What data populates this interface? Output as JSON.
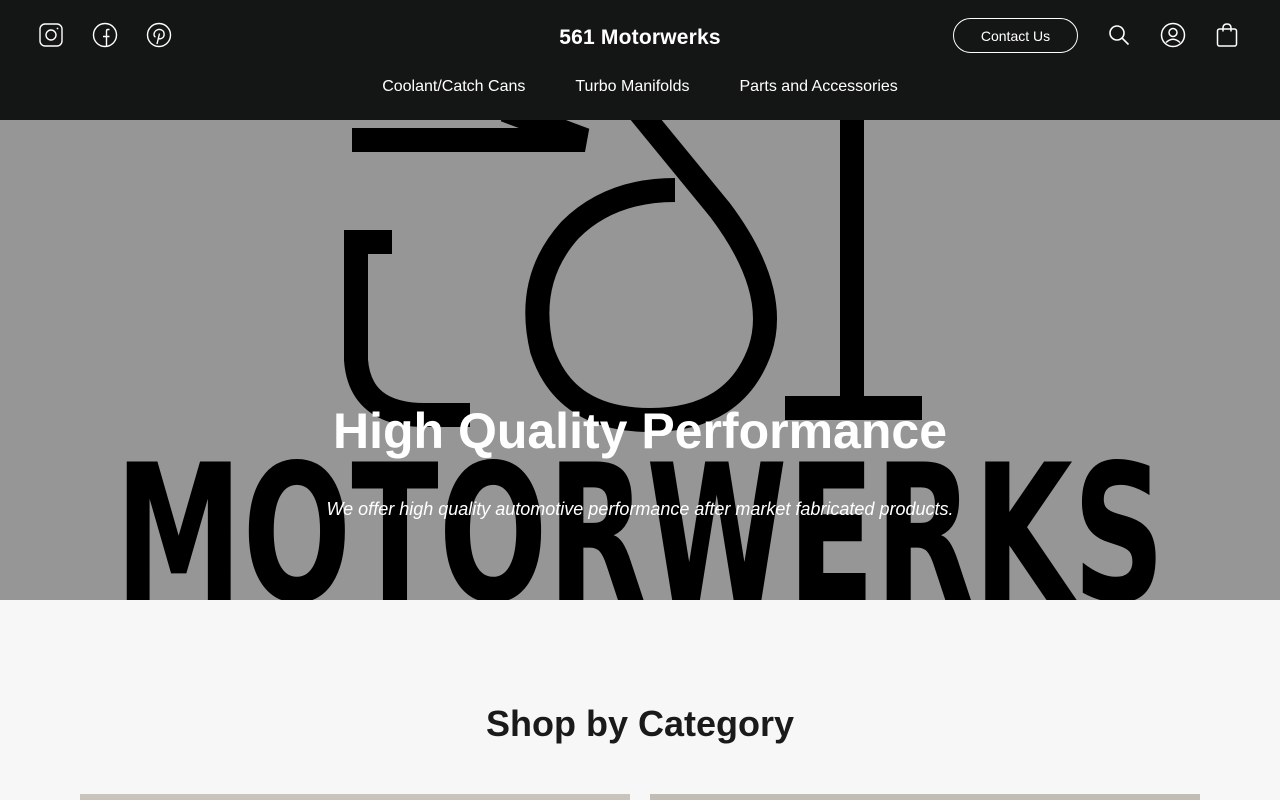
{
  "header": {
    "brand": "561 Motorwerks",
    "contact_label": "Contact Us",
    "social_icons": [
      "instagram-icon",
      "facebook-icon",
      "pinterest-icon"
    ],
    "utility_icons": [
      "search-icon",
      "account-icon",
      "cart-icon"
    ],
    "nav": [
      "Coolant/Catch Cans",
      "Turbo Manifolds",
      "Parts and Accessories"
    ]
  },
  "hero": {
    "logo_text_top": "561",
    "logo_text_bottom": "MOTORWERKS",
    "title": "High Quality Performance",
    "subtitle": "We offer high quality automotive performance after market fabricated products."
  },
  "shop": {
    "title": "Shop by Category"
  },
  "colors": {
    "header_bg": "#141515",
    "hero_bg": "#969696",
    "page_bg": "#f7f7f7"
  }
}
